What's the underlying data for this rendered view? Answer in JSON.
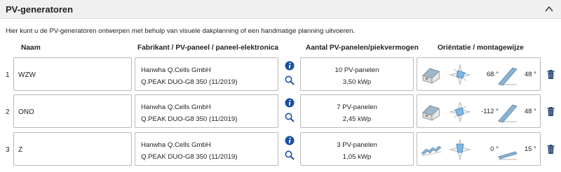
{
  "header": {
    "title": "PV-generatoren",
    "collapse_icon": "chevron-up-icon"
  },
  "intro": "Hier kunt u de PV-generatoren ontwerpen met behulp van visuele dakplanning of een handmatige planning uitvoeren.",
  "columns": {
    "name": "Naam",
    "module": "Fabrikant / PV-paneel / paneel-elektronica",
    "panels": "Aantal PV-panelen/piekvermogen",
    "orientation": "Oriëntatie / montagewijze"
  },
  "colors": {
    "info": "#1a4fa0",
    "trash": "#1e3c6e",
    "border": "#b8b8b8",
    "header_bg": "#f0f0f0"
  },
  "rows": [
    {
      "index": "1",
      "name": "WZW",
      "manufacturer": "Hanwha Q.Cells GmbH",
      "module": "Q.PEAK DUO-G8 350 (11/2019)",
      "panels": "10 PV-panelen",
      "power": "3,50 kWp",
      "mount": "roof-mounted",
      "azimuth": "68 °",
      "tilt": "48 °"
    },
    {
      "index": "2",
      "name": "ONO",
      "manufacturer": "Hanwha Q.Cells GmbH",
      "module": "Q.PEAK DUO-G8 350 (11/2019)",
      "panels": "7 PV-panelen",
      "power": "2,45 kWp",
      "mount": "roof-mounted",
      "azimuth": "-112 °",
      "tilt": "48 °"
    },
    {
      "index": "3",
      "name": "Z",
      "manufacturer": "Hanwha Q.Cells GmbH",
      "module": "Q.PEAK DUO-G8 350 (11/2019)",
      "panels": "3 PV-panelen",
      "power": "1,05 kWp",
      "mount": "rack-mounted",
      "azimuth": "0 °",
      "tilt": "15 °"
    }
  ]
}
